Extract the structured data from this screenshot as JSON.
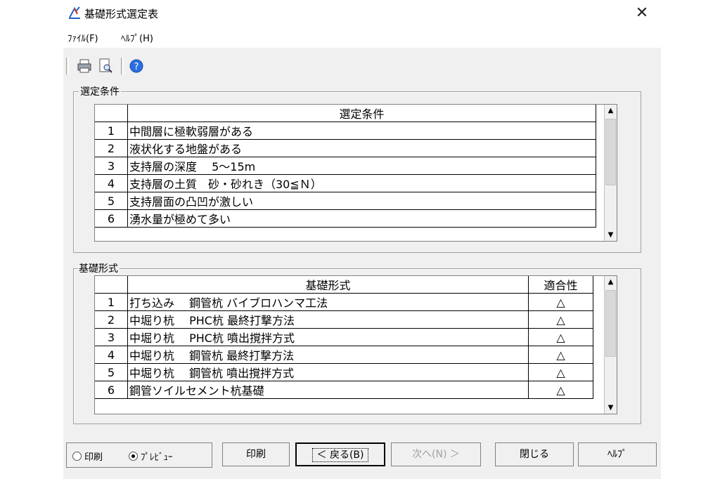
{
  "window": {
    "title": "基礎形式選定表",
    "close_label": "✕"
  },
  "menu": [
    {
      "label": "ﾌｧｲﾙ(F)"
    },
    {
      "label": "ﾍﾙﾌﾟ(H)"
    }
  ],
  "toolbar": {
    "icons": [
      "printer-icon",
      "print-preview-icon",
      "help-icon"
    ]
  },
  "conditions": {
    "group_label": "選定条件",
    "header": "選定条件",
    "rows": [
      {
        "no": "1",
        "text": "中間層に極軟弱層がある"
      },
      {
        "no": "2",
        "text": "液状化する地盤がある"
      },
      {
        "no": "3",
        "text": "支持層の深度　 5～15m"
      },
      {
        "no": "4",
        "text": "支持層の土質　砂・砂れき（30≦Ｎ）"
      },
      {
        "no": "5",
        "text": "支持層面の凸凹が激しい"
      },
      {
        "no": "6",
        "text": "湧水量が極めて多い"
      }
    ]
  },
  "foundations": {
    "group_label": "基礎形式",
    "header_type": "基礎形式",
    "header_fit": "適合性",
    "rows": [
      {
        "no": "1",
        "text": "打ち込み　 鋼管杭 バイブロハンマ工法",
        "fit": "△"
      },
      {
        "no": "2",
        "text": "中堀り杭 　PHC杭 最終打撃方法",
        "fit": "△"
      },
      {
        "no": "3",
        "text": "中堀り杭 　PHC杭 噴出撹拌方式",
        "fit": "△"
      },
      {
        "no": "4",
        "text": "中堀り杭 　鋼管杭 最終打撃方法",
        "fit": "△"
      },
      {
        "no": "5",
        "text": "中堀り杭 　鋼管杭 噴出撹拌方式",
        "fit": "△"
      },
      {
        "no": "6",
        "text": "鋼管ソイルセメント杭基礎",
        "fit": "△"
      }
    ]
  },
  "output_mode": {
    "options": [
      {
        "label": "印刷",
        "selected": false
      },
      {
        "label": "ﾌﾟﾚﾋﾞｭｰ",
        "selected": true
      }
    ]
  },
  "buttons": {
    "print": "印刷",
    "back": "＜ 戻る(B)",
    "next": "次へ(N) ＞",
    "close": "閉じる",
    "help": "ﾍﾙﾌﾟ"
  }
}
